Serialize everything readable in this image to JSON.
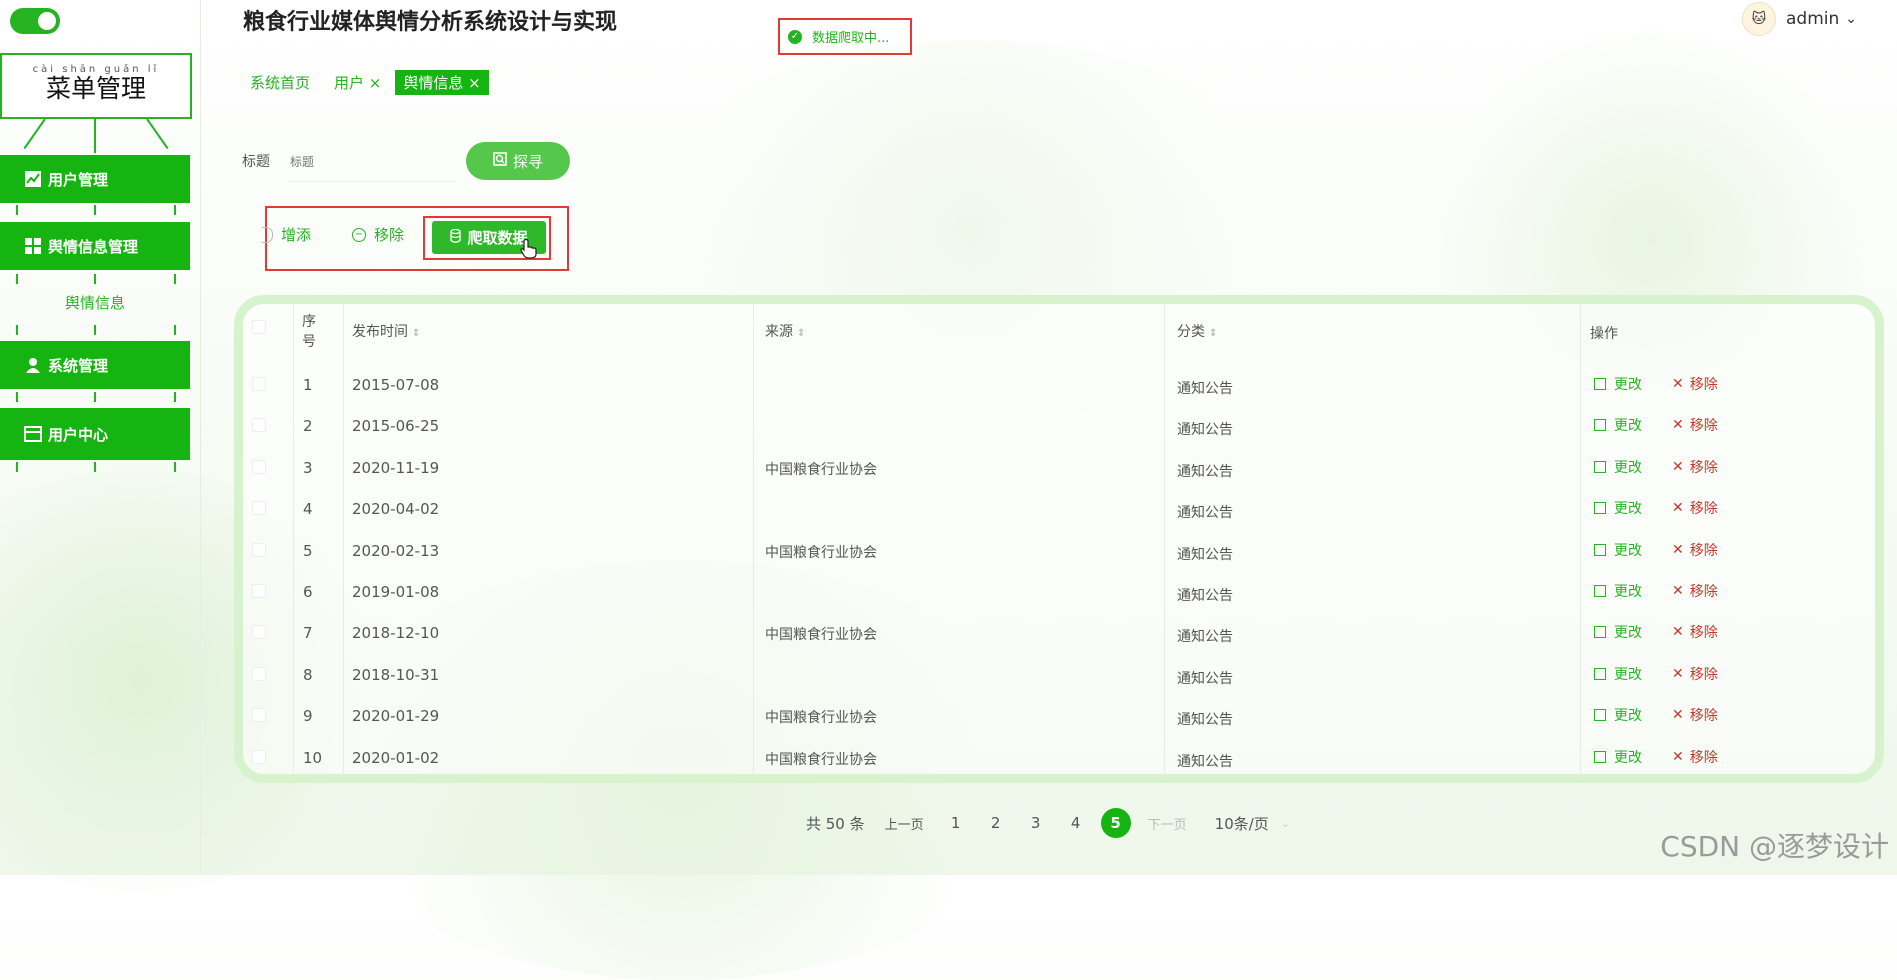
{
  "header": {
    "title": "粮食行业媒体舆情分析系统设计与实现",
    "status": "数据爬取中...",
    "user": "admin",
    "user_caret": "⌄"
  },
  "sidebar": {
    "pinyin": "cài  shān guǎn  lǐ",
    "menu_title": "菜单管理",
    "items": [
      {
        "label": "用户管理"
      },
      {
        "label": "舆情信息管理"
      },
      {
        "label": "系统管理"
      },
      {
        "label": "用户中心"
      }
    ],
    "sub_item": "舆情信息"
  },
  "tabs": [
    {
      "label": "系统首页"
    },
    {
      "label": "用户 ×"
    },
    {
      "label": "舆情信息 ×"
    }
  ],
  "search": {
    "label": "标题",
    "placeholder": "标题",
    "button": "探寻"
  },
  "actions": {
    "add": "增添",
    "remove": "移除",
    "crawl": "爬取数据"
  },
  "table": {
    "headers": {
      "index_1": "序",
      "index_2": "号",
      "date": "发布时间",
      "source": "来源",
      "category": "分类",
      "ops": "操作"
    },
    "sort_glyph": "⇕",
    "edit_label": "更改",
    "delete_label": "移除",
    "rows": [
      {
        "no": "1",
        "date": "2015-07-08",
        "source": "",
        "category": "通知公告"
      },
      {
        "no": "2",
        "date": "2015-06-25",
        "source": "",
        "category": "通知公告"
      },
      {
        "no": "3",
        "date": "2020-11-19",
        "source": "中国粮食行业协会",
        "category": "通知公告"
      },
      {
        "no": "4",
        "date": "2020-04-02",
        "source": "",
        "category": "通知公告"
      },
      {
        "no": "5",
        "date": "2020-02-13",
        "source": "中国粮食行业协会",
        "category": "通知公告"
      },
      {
        "no": "6",
        "date": "2019-01-08",
        "source": "",
        "category": "通知公告"
      },
      {
        "no": "7",
        "date": "2018-12-10",
        "source": "中国粮食行业协会",
        "category": "通知公告"
      },
      {
        "no": "8",
        "date": "2018-10-31",
        "source": "",
        "category": "通知公告"
      },
      {
        "no": "9",
        "date": "2020-01-29",
        "source": "中国粮食行业协会",
        "category": "通知公告"
      },
      {
        "no": "10",
        "date": "2020-01-02",
        "source": "中国粮食行业协会",
        "category": "通知公告"
      }
    ]
  },
  "pagination": {
    "total": "共 50 条",
    "prev": "上一页",
    "pages": [
      "1",
      "2",
      "3",
      "4"
    ],
    "current": "5",
    "next": "下一页",
    "page_size": "10条/页"
  },
  "watermark": "CSDN @逐梦设计",
  "colors": {
    "accent": "#15b410",
    "highlight_box": "#e53935",
    "delete": "#c0392b"
  }
}
